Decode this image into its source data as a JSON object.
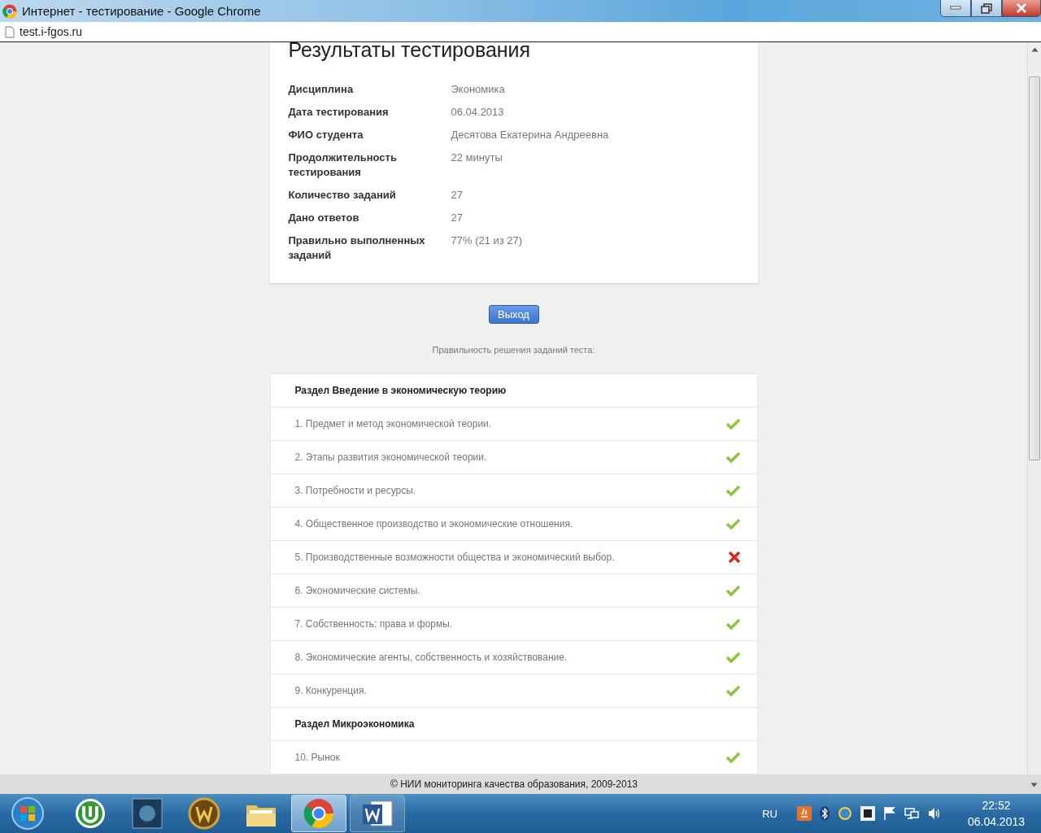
{
  "window": {
    "title": "Интернет - тестирование - Google Chrome",
    "url": "test.i-fgos.ru"
  },
  "page": {
    "heading": "Результаты тестирования",
    "details": [
      {
        "label": "Дисциплина",
        "value": "Экономика"
      },
      {
        "label": "Дата тестирования",
        "value": "06.04.2013"
      },
      {
        "label": "ФИО студента",
        "value": "Десятова Екатерина Андреевна"
      },
      {
        "label": "Продолжительность тестирования",
        "value": "22 минуты"
      },
      {
        "label": "Количество заданий",
        "value": "27"
      },
      {
        "label": "Дано ответов",
        "value": "27"
      },
      {
        "label": "Правильно выполненных заданий",
        "value": "77% (21 из 27)"
      }
    ],
    "exit_button": "Выход",
    "caption": "Правильность решения заданий теста:",
    "sections": [
      {
        "title": "Раздел Введение в экономическую теорию",
        "tasks": [
          {
            "text": "1. Предмет и метод экономической теории.",
            "correct": true
          },
          {
            "text": "2. Этапы развития экономической теории.",
            "correct": true
          },
          {
            "text": "3. Потребности и ресурсы.",
            "correct": true
          },
          {
            "text": "4. Общественное производство и экономические отношения.",
            "correct": true
          },
          {
            "text": "5. Производственные возможности общества и экономический выбор.",
            "correct": false
          },
          {
            "text": "6. Экономические системы.",
            "correct": true
          },
          {
            "text": "7. Собственность: права и формы.",
            "correct": true
          },
          {
            "text": "8. Экономические агенты, собственность и хозяйствование.",
            "correct": true
          },
          {
            "text": "9. Конкуренция.",
            "correct": true
          }
        ]
      },
      {
        "title": "Раздел Микроэкономика",
        "tasks": [
          {
            "text": "10. Рынок",
            "correct": true
          }
        ]
      }
    ],
    "footer": "© НИИ мониторинга качества образования, 2009-2013"
  },
  "taskbar": {
    "language": "RU",
    "time": "22:52",
    "date": "06.04.2013"
  }
}
